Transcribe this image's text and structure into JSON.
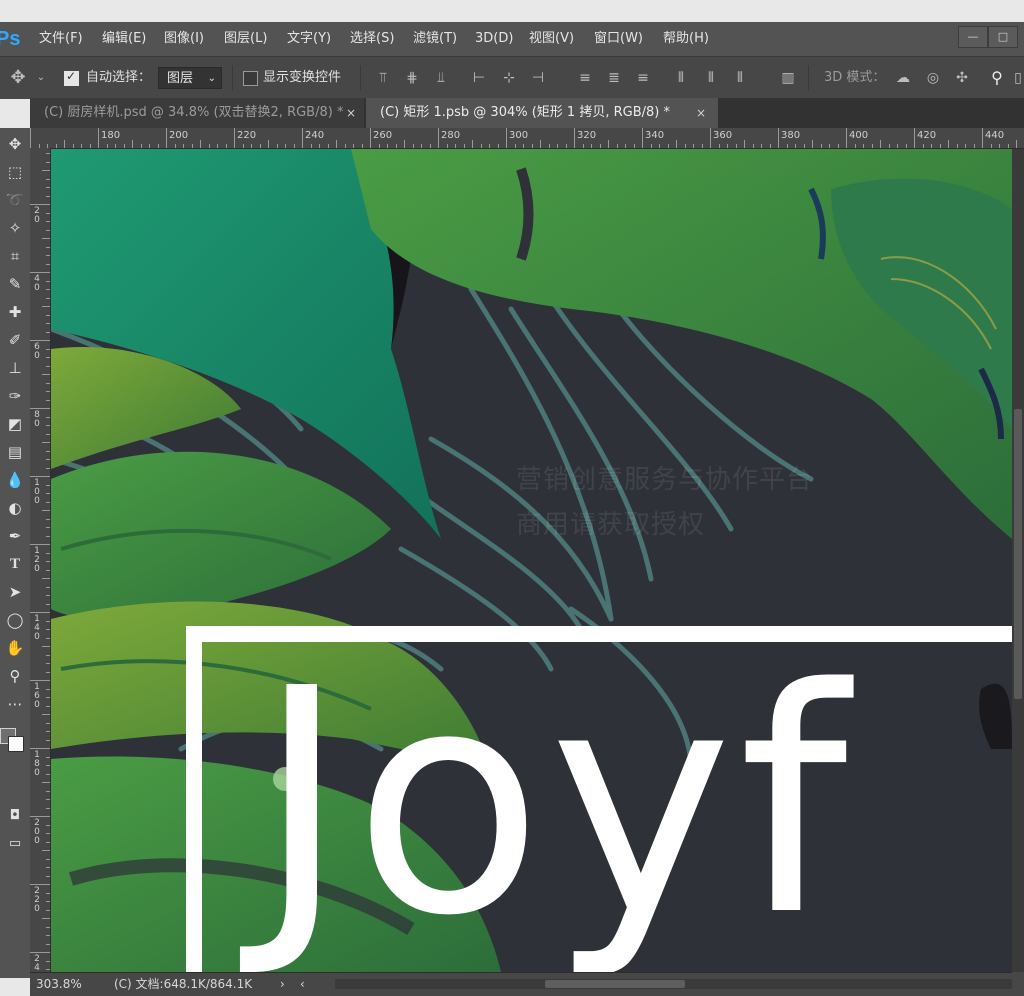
{
  "app": {
    "logo_text": "Ps",
    "menu": [
      "文件(F)",
      "编辑(E)",
      "图像(I)",
      "图层(L)",
      "文字(Y)",
      "选择(S)",
      "滤镜(T)",
      "3D(D)",
      "视图(V)",
      "窗口(W)",
      "帮助(H)"
    ],
    "window_controls": [
      "—",
      "□"
    ]
  },
  "options": {
    "auto_select_label": "自动选择：",
    "auto_select_checked": true,
    "auto_select_target": "图层",
    "show_transform_label": "显示变换控件",
    "show_transform_checked": false,
    "mode_3d_label": "3D 模式："
  },
  "tabs": [
    {
      "label": "(C) 厨房样机.psd @ 34.8% (双击替换2, RGB/8) *",
      "active": false,
      "close": "×"
    },
    {
      "label": "(C) 矩形 1.psb @ 304% (矩形 1 拷贝, RGB/8) *",
      "active": true,
      "close": "×"
    }
  ],
  "ruler": {
    "top_labels": [
      "180",
      "200",
      "220",
      "240",
      "260",
      "280",
      "300",
      "320",
      "340",
      "360",
      "380",
      "400",
      "420",
      "440"
    ],
    "left_labels": [
      "20",
      "40",
      "60",
      "80",
      "100",
      "120",
      "140",
      "160",
      "180",
      "200",
      "220",
      "240"
    ]
  },
  "canvas": {
    "watermark_line1": "营销创意服务与协作平台",
    "watermark_line2": "商用请获取授权",
    "big_text": "Joyf",
    "colors": {
      "background": "#2e3137",
      "leaf_teal": "#1d8a6a",
      "leaf_green": "#3f8f45",
      "leaf_lime": "#6fa23a",
      "outline": "#4f7f7e",
      "frame": "#ffffff"
    }
  },
  "status": {
    "zoom": "303.8%",
    "doc_info": "(C) 文档:648.1K/864.1K",
    "arrow": "›"
  }
}
